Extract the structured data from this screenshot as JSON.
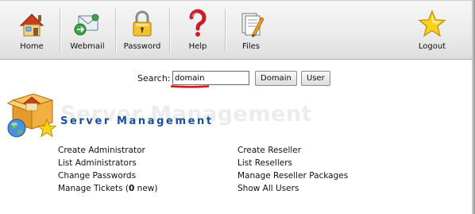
{
  "toolbar": {
    "items": [
      {
        "label": "Home",
        "icon": "home-icon"
      },
      {
        "label": "Webmail",
        "icon": "webmail-icon"
      },
      {
        "label": "Password",
        "icon": "padlock-icon"
      },
      {
        "label": "Help",
        "icon": "question-mark-icon"
      },
      {
        "label": "Files",
        "icon": "files-icon"
      },
      {
        "label": "Logout",
        "icon": "star-icon"
      }
    ]
  },
  "search": {
    "label": "Search:",
    "value": "domain",
    "buttons": [
      "Domain",
      "User"
    ]
  },
  "section": {
    "title": "Server Management",
    "left_links": [
      "Create Administrator",
      "List Administrators",
      "Change Passwords"
    ],
    "tickets": {
      "prefix": "Manage Tickets (",
      "count": "0",
      "suffix": " new)"
    },
    "right_links": [
      "Create Reseller",
      "List Resellers",
      "Manage Reseller Packages",
      "Show All Users"
    ]
  },
  "colors": {
    "title_blue": "#1b4f9c",
    "annotation_red": "#dd1111"
  }
}
